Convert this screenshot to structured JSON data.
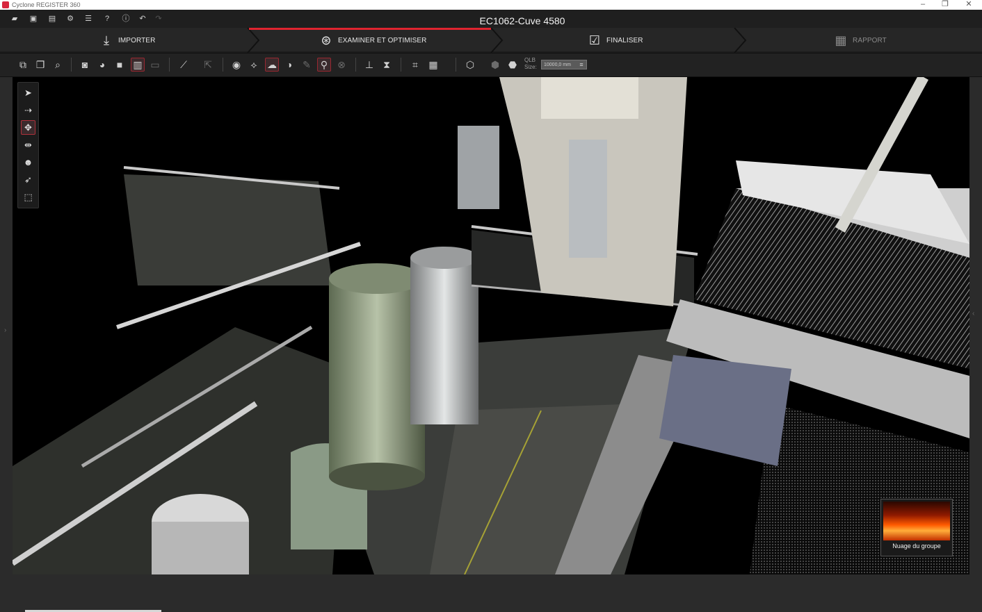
{
  "window": {
    "app_title": "Cyclone REGISTER 360",
    "controls": {
      "minimize": "–",
      "restore": "❐",
      "close": "✕"
    }
  },
  "header": {
    "document_title": "EC1062-Cuve 4580",
    "quick_icons": [
      "open-folder-icon",
      "save-icon",
      "list-icon",
      "gear-icon",
      "database-icon",
      "help-icon",
      "info-icon",
      "undo-icon",
      "redo-icon"
    ]
  },
  "workflow_tabs": [
    {
      "label": "IMPORTER",
      "icon": "import-icon",
      "state": "normal"
    },
    {
      "label": "EXAMINER ET OPTIMISER",
      "icon": "review-icon",
      "state": "active"
    },
    {
      "label": "FINALISER",
      "icon": "finalize-icon",
      "state": "normal"
    },
    {
      "label": "RAPPORT",
      "icon": "report-icon",
      "state": "disabled"
    }
  ],
  "toolbar": {
    "qlb_label": "QLB\nSize:",
    "qlb_value": "10000,0 mm"
  },
  "viewport": {
    "thumbnail_caption": "Nuage du groupe"
  },
  "colors": {
    "accent": "#e0242f",
    "background": "#2b2b2b",
    "viewport": "#000000"
  }
}
